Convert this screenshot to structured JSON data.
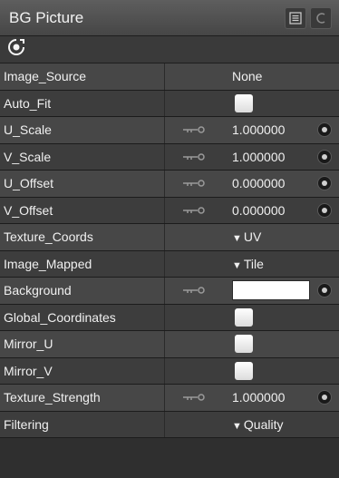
{
  "window": {
    "title": "BG Picture"
  },
  "rows": [
    {
      "label": "Image_Source",
      "value": "None"
    },
    {
      "label": "Auto_Fit"
    },
    {
      "label": "U_Scale",
      "value": "1.000000"
    },
    {
      "label": "V_Scale",
      "value": "1.000000"
    },
    {
      "label": "U_Offset",
      "value": "0.000000"
    },
    {
      "label": "V_Offset",
      "value": "0.000000"
    },
    {
      "label": "Texture_Coords",
      "value": "UV"
    },
    {
      "label": "Image_Mapped",
      "value": "Tile"
    },
    {
      "label": "Background",
      "color": "#ffffff"
    },
    {
      "label": "Global_Coordinates"
    },
    {
      "label": "Mirror_U"
    },
    {
      "label": "Mirror_V"
    },
    {
      "label": "Texture_Strength",
      "value": "1.000000"
    },
    {
      "label": "Filtering",
      "value": "Quality"
    }
  ],
  "icons": {
    "toolbar": "target-icon",
    "menu": "menu-icon",
    "options": "panel-options-icon",
    "key": "key-icon",
    "link": "link-dot-icon",
    "dropdown": "dropdown-arrow-icon"
  },
  "colors": {
    "title_bar": "#5e5e5e",
    "row_light": "#474747",
    "row_dark": "#3d3d3d"
  }
}
